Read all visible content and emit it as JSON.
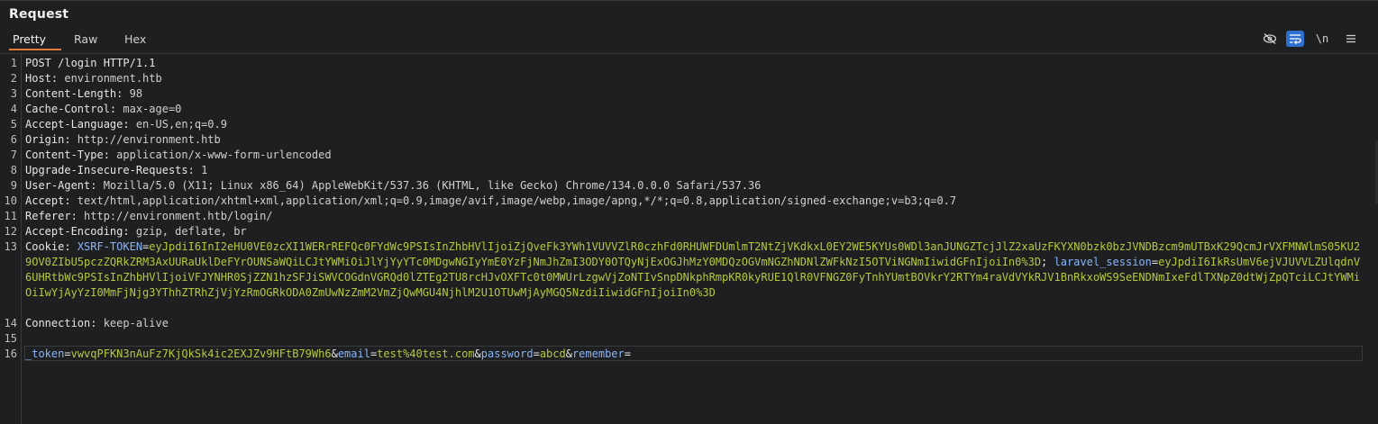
{
  "panel": {
    "title": "Request"
  },
  "tabs": [
    {
      "label": "Pretty",
      "active": true
    },
    {
      "label": "Raw",
      "active": false
    },
    {
      "label": "Hex",
      "active": false
    }
  ],
  "toolbar": {
    "icons": [
      "hide-nonprintable-icon",
      "wrap-lines-icon",
      "newline-icon",
      "menu-icon"
    ],
    "newline_label": "\\n"
  },
  "colors": {
    "accent": "#e07a3a",
    "active_tool": "#2f6fd0",
    "param_key": "#8ab4f8",
    "param_value": "#b5c93a"
  },
  "lines": {
    "l1": "POST /login HTTP/1.1",
    "l2_key": "Host:",
    "l2_val": " environment.htb",
    "l3_key": "Content-Length:",
    "l3_val": " 98",
    "l4_key": "Cache-Control:",
    "l4_val": " max-age=0",
    "l5_key": "Accept-Language:",
    "l5_val": " en-US,en;q=0.9",
    "l6_key": "Origin:",
    "l6_val": " http://environment.htb",
    "l7_key": "Content-Type:",
    "l7_val": " application/x-www-form-urlencoded",
    "l8_key": "Upgrade-Insecure-Requests:",
    "l8_val": " 1",
    "l9_key": "User-Agent:",
    "l9_val": " Mozilla/5.0 (X11; Linux x86_64) AppleWebKit/537.36 (KHTML, like Gecko) Chrome/134.0.0.0 Safari/537.36",
    "l10_key": "Accept:",
    "l10_val": " text/html,application/xhtml+xml,application/xml;q=0.9,image/avif,image/webp,image/apng,*/*;q=0.8,application/signed-exchange;v=b3;q=0.7",
    "l11_key": "Referer:",
    "l11_val": " http://environment.htb/login/",
    "l12_key": "Accept-Encoding:",
    "l12_val": " gzip, deflate, br",
    "l13_key": "Cookie:",
    "cookie1_name": "XSRF-TOKEN",
    "cookie1_eq": "=",
    "cookie1_value": "eyJpdiI6InI2eHU0VE0zcXI1WERrREFQc0FYdWc9PSIsInZhbHVlIjoiZjQveFk3YWh1VUVVZlR0czhFd0RHUWFDUmlmT2NtZjVKdkxL0EY2WE5KYUs0WDl3anJUNGZTcjJlZ2xaUzFKYXN0bzk0bzJVNDBzcm9mUTBxK29QcmJrVXFMNWlmS05KU29OV0ZIbU5pczZQRkZRM3AxUURaUklDeFYrOUNSaWQiLCJtYWMiOiJlYjYyYTc0MDgwNGIyYmE0YzFjNmJhZmI3ODY0OTQyNjExOGJhMzY0MDQzOGVmNGZhNDNlZWFkNzI5OTViNGNmIiwidGFnIjoiIn0%3D",
    "cookie_sep": "; ",
    "cookie2_name": "laravel_session",
    "cookie2_eq": "=",
    "cookie2_value": "eyJpdiI6IkRsUmV6ejVJUVVLZUlqdnV6UHRtbWc9PSIsInZhbHVlIjoiVFJYNHR0SjZZN1hzSFJiSWVCOGdnVGRQd0lZTEg2TU8rcHJvOXFTc0t0MWUrLzgwVjZoNTIvSnpDNkphRmpKR0kyRUE1QlR0VFNGZ0FyTnhYUmtBOVkrY2RTYm4raVdVYkRJV1BnRkxoWS9SeENDNmIxeFdlTXNpZ0dtWjZpQTciLCJtYWMiOiIwYjAyYzI0MmFjNjg3YThhZTRhZjVjYzRmOGRkODA0ZmUwNzZmM2VmZjQwMGU4NjhlM2U1OTUwMjAyMGQ5NzdiIiwidGFnIjoiIn0%3D",
    "l14_key": "Connection:",
    "l14_val": " keep-alive",
    "body_k1": "_token",
    "body_eq1": "=",
    "body_v1": "vwvqPFKN3nAuFz7KjQkSk4ic2EXJZv9HFtB79Wh6",
    "body_amp1": "&",
    "body_k2": "email",
    "body_eq2": "=",
    "body_v2": "test%40test.com",
    "body_amp2": "&",
    "body_k3": "password",
    "body_eq3": "=",
    "body_v3": "abcd",
    "body_amp3": "&",
    "body_k4": "remember",
    "body_eq4": "="
  },
  "line_numbers": [
    "1",
    "2",
    "3",
    "4",
    "5",
    "6",
    "7",
    "8",
    "9",
    "10",
    "11",
    "12",
    "13",
    "14",
    "15",
    "16"
  ]
}
